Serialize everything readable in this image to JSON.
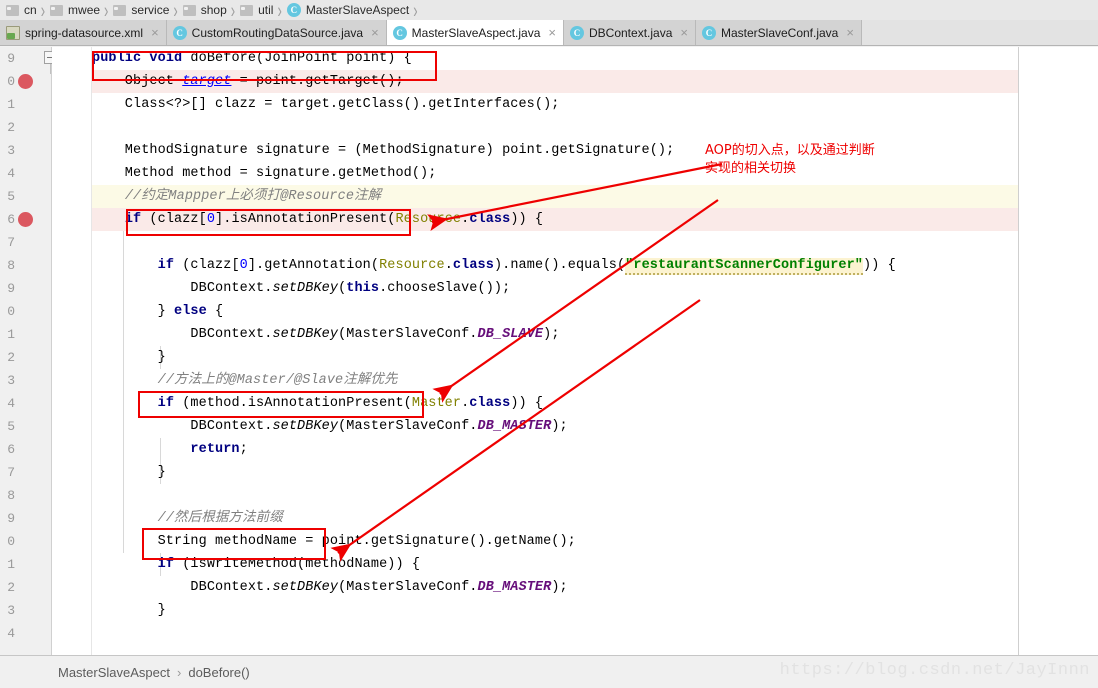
{
  "breadcrumb": {
    "items": [
      {
        "label": "cn",
        "icon": "folder-icon"
      },
      {
        "label": "mwee",
        "icon": "folder-icon"
      },
      {
        "label": "service",
        "icon": "folder-icon"
      },
      {
        "label": "shop",
        "icon": "folder-icon"
      },
      {
        "label": "util",
        "icon": "folder-icon"
      },
      {
        "label": "MasterSlaveAspect",
        "icon": "java-class-icon"
      }
    ],
    "separator": "›"
  },
  "tabs": {
    "close_glyph": "×",
    "items": [
      {
        "label": "spring-datasource.xml",
        "icon": "xml-file-icon",
        "active": false
      },
      {
        "label": "CustomRoutingDataSource.java",
        "icon": "java-class-icon",
        "active": false
      },
      {
        "label": "MasterSlaveAspect.java",
        "icon": "java-class-icon",
        "active": true
      },
      {
        "label": "DBContext.java",
        "icon": "java-class-icon",
        "active": false
      },
      {
        "label": "MasterSlaveConf.java",
        "icon": "java-class-icon",
        "active": false
      }
    ]
  },
  "editor": {
    "line_numbers": [
      "9",
      "0",
      "1",
      "2",
      "3",
      "4",
      "5",
      "6",
      "7",
      "8",
      "9",
      "0",
      "1",
      "2",
      "3",
      "4",
      "5",
      "6",
      "7",
      "8",
      "9",
      "0",
      "1",
      "2",
      "3",
      "4"
    ],
    "breakpoint_rows": [
      1,
      7
    ],
    "highlight_pink_rows": [
      1,
      7
    ],
    "highlight_yellow_rows": [
      6
    ],
    "lines": [
      "public void doBefore(JoinPoint point) {",
      "    Object target = point.getTarget();",
      "    Class<?>[] clazz = target.getClass().getInterfaces();",
      "",
      "    MethodSignature signature = (MethodSignature) point.getSignature();",
      "    Method method = signature.getMethod();",
      "",
      "    //约定Mappper上必须打@Resource注解",
      "    if (clazz[0].isAnnotationPresent(Resource.class)) {",
      "",
      "        if (clazz[0].getAnnotation(Resource.class).name().equals(\"restaurantScannerConfigurer\")) {",
      "            DBContext.setDBKey(this.chooseSlave());",
      "        } else {",
      "            DBContext.setDBKey(MasterSlaveConf.DB_SLAVE);",
      "        }",
      "        //方法上的@Master/@Slave注解优先",
      "        if (method.isAnnotationPresent(Master.class)) {",
      "            DBContext.setDBKey(MasterSlaveConf.DB_MASTER);",
      "            return;",
      "        }",
      "",
      "        //然后根据方法前缀",
      "        String methodName = point.getSignature().getName();",
      "        if (isWriteMethod(methodName)) {",
      "            DBContext.setDBKey(MasterSlaveConf.DB_MASTER);",
      "        }"
    ],
    "highlighted_string_literal": "\"restaurantScannerConfigurer\""
  },
  "annotations": {
    "note_text": "AOP的切入点，以及通过判断\n实现的相关切换",
    "boxed_comments": [
      "//约定Mappper上必须打@Resource注解",
      "//方法上的@Master/@Slave注解优先",
      "//然后根据方法前缀"
    ],
    "box_on_signature": "public void doBefore(JoinPoint point) {",
    "accent_color": "#ee0000"
  },
  "status": {
    "crumb_class": "MasterSlaveAspect",
    "crumb_separator": "›",
    "crumb_method": "doBefore()",
    "watermark": "https://blog.csdn.net/JayInnn"
  }
}
